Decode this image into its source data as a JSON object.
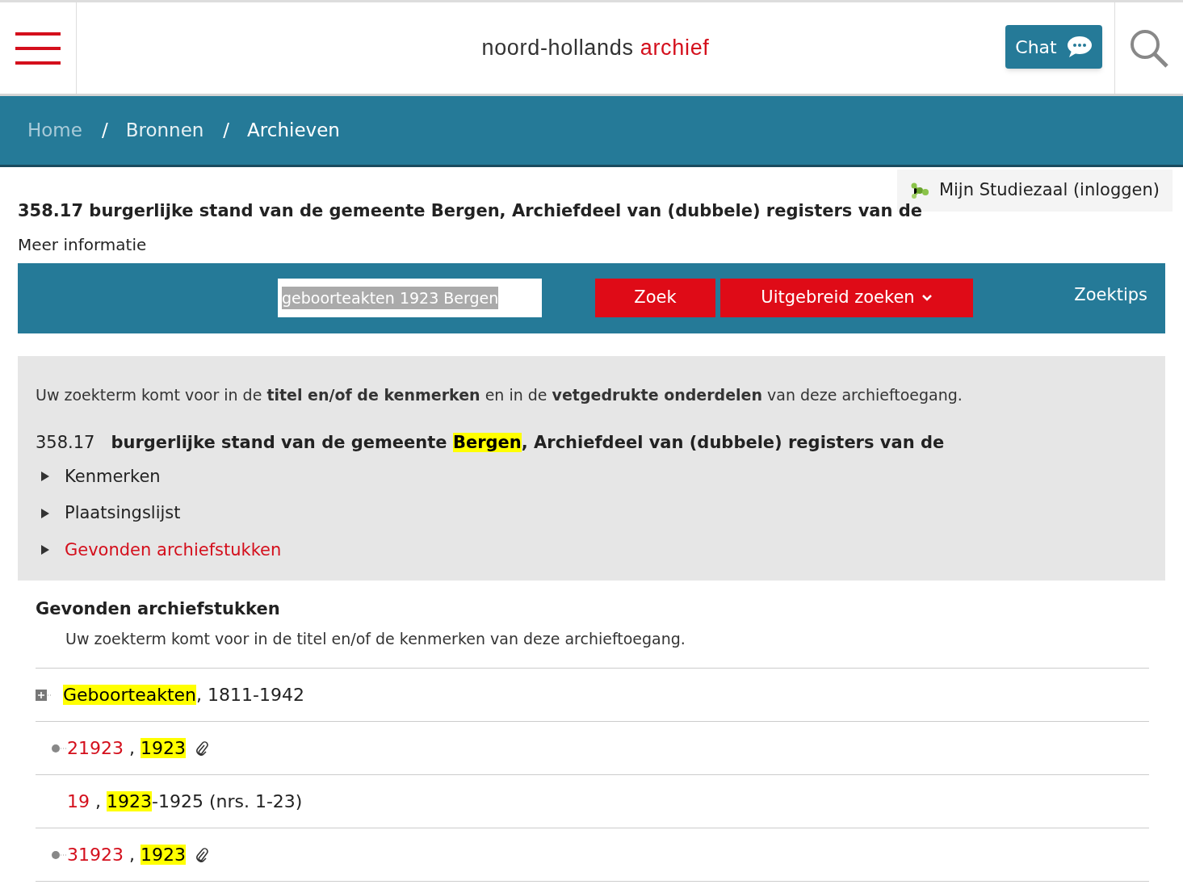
{
  "header": {
    "logo": {
      "primary": "noord-hollands",
      "accent": "archief"
    },
    "chat_button": "Chat"
  },
  "breadcrumb": {
    "separator": "/",
    "items": [
      {
        "label": "Home",
        "selected": false
      },
      {
        "label": "Bronnen",
        "selected": false
      },
      {
        "label": "Archieven",
        "selected": true
      }
    ]
  },
  "login_link": "Mijn Studiezaal (inloggen)",
  "archive_title": "358.17 burgerlijke stand van de gemeente Bergen, Archiefdeel van (dubbele) registers van de",
  "more_info": "Meer informatie",
  "search": {
    "value": "geboorteakten 1923 Bergen",
    "text_selected": true,
    "search_button": "Zoek",
    "advanced_button": "Uitgebreid zoeken",
    "tips_link": "Zoektips"
  },
  "info_panel": {
    "intro": "Uw zoekterm komt voor in de **titel en/of de kenmerken** en in de **vetgedrukte onderdelen** van deze archieftoegang.",
    "code": "358.17",
    "title_parts": [
      {
        "text": "burgerlijke stand van de gemeente ",
        "kind": "plain"
      },
      {
        "text": "Bergen",
        "kind": "highlight"
      },
      {
        "text": ", Archiefdeel van (dubbele) registers van de",
        "kind": "plain"
      }
    ],
    "sections": [
      {
        "label": "Kenmerken",
        "expanded": false,
        "selected": false
      },
      {
        "label": "Plaatsingslijst",
        "expanded": false,
        "selected": false
      },
      {
        "label": "Gevonden archiefstukken",
        "expanded": false,
        "selected": true
      }
    ]
  },
  "results": {
    "heading": "Gevonden archiefstukken",
    "note": "Uw zoekterm komt voor in de titel en/of de kenmerken van deze archieftoegang.",
    "rows": [
      {
        "kind": "folder",
        "attachment": false,
        "parts": [
          {
            "text": "Geboorteakten",
            "kind": "highlight"
          },
          {
            "text": ", 1811-1942",
            "kind": "plain"
          }
        ]
      },
      {
        "kind": "item",
        "attachment": true,
        "parts": [
          {
            "text": "21923",
            "kind": "link"
          },
          {
            "text": " , ",
            "kind": "plain"
          },
          {
            "text": "1923",
            "kind": "highlight"
          }
        ]
      },
      {
        "kind": "plain",
        "attachment": false,
        "parts": [
          {
            "text": "19",
            "kind": "link"
          },
          {
            "text": " , ",
            "kind": "plain"
          },
          {
            "text": "1923",
            "kind": "highlight"
          },
          {
            "text": "-1925 (nrs. 1-23)",
            "kind": "plain"
          }
        ]
      },
      {
        "kind": "item",
        "attachment": true,
        "parts": [
          {
            "text": "31923",
            "kind": "link"
          },
          {
            "text": " , ",
            "kind": "plain"
          },
          {
            "text": "1923",
            "kind": "highlight"
          }
        ]
      }
    ]
  }
}
